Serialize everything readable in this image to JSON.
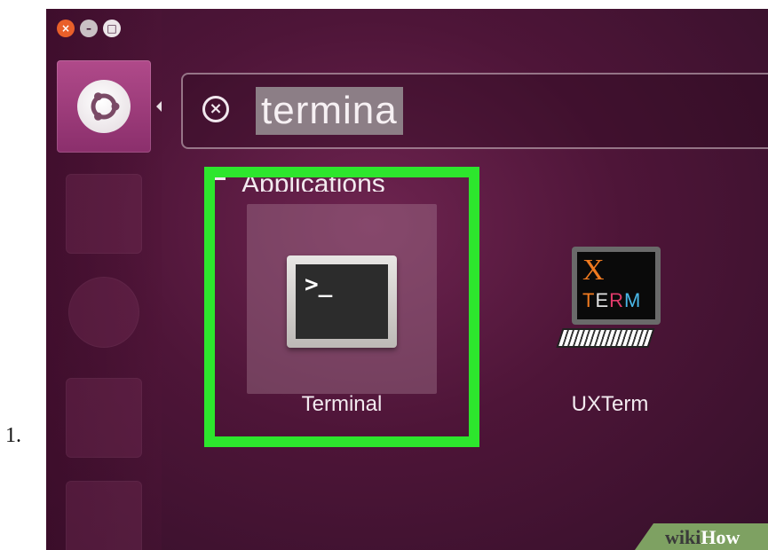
{
  "step": {
    "number": "1."
  },
  "window": {
    "controls": [
      {
        "name": "close",
        "glyph": "×"
      },
      {
        "name": "minimize",
        "glyph": "–"
      },
      {
        "name": "maximize",
        "glyph": "□"
      }
    ]
  },
  "launcher": {
    "dash_icon": "ubuntu-logo-icon",
    "items": [
      "files-icon",
      "firefox-icon",
      "document-icon",
      "spreadsheet-icon"
    ]
  },
  "search": {
    "clear_glyph": "×",
    "value": "termina"
  },
  "results": {
    "category": "Applications",
    "apps": [
      {
        "label": "Terminal",
        "icon": "terminal-icon",
        "prompt": ">_"
      },
      {
        "label": "UXTerm",
        "icon": "xterm-icon",
        "badge_x": "X",
        "badge_term": "TERM"
      }
    ]
  },
  "highlight": {
    "color": "#2de62d"
  },
  "watermark": {
    "part1": "wiki",
    "part2": "How"
  }
}
